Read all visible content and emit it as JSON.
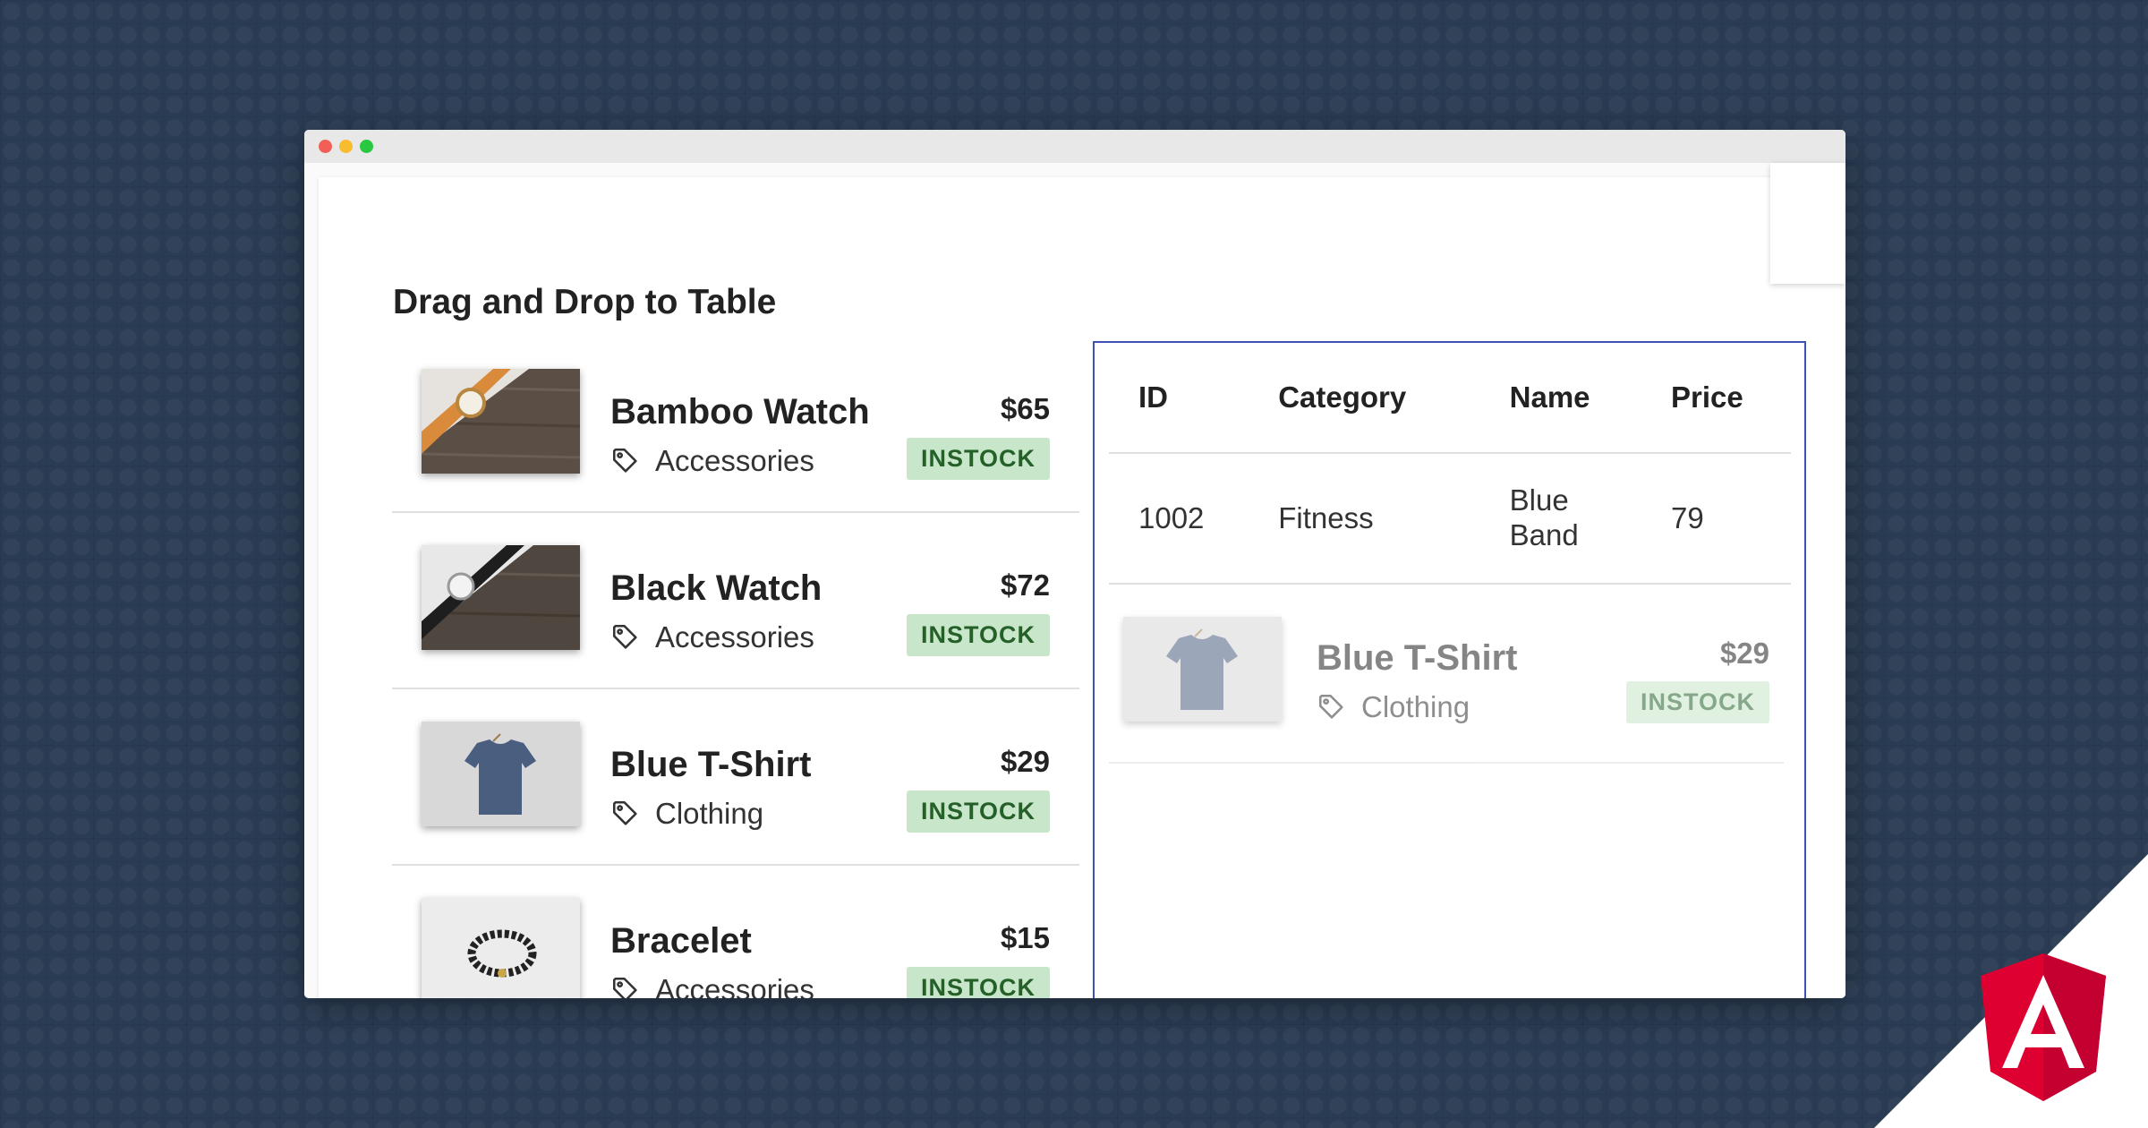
{
  "page": {
    "title": "Drag and Drop to Table"
  },
  "products": [
    {
      "name": "Bamboo Watch",
      "category": "Accessories",
      "price": "$65",
      "status": "INSTOCK",
      "image_icon": "bamboo-watch-image"
    },
    {
      "name": "Black Watch",
      "category": "Accessories",
      "price": "$72",
      "status": "INSTOCK",
      "image_icon": "black-watch-image"
    },
    {
      "name": "Blue T-Shirt",
      "category": "Clothing",
      "price": "$29",
      "status": "INSTOCK",
      "image_icon": "blue-tshirt-image"
    },
    {
      "name": "Bracelet",
      "category": "Accessories",
      "price": "$15",
      "status": "INSTOCK",
      "image_icon": "bracelet-image"
    }
  ],
  "table": {
    "headers": [
      "ID",
      "Category",
      "Name",
      "Price"
    ],
    "rows": [
      {
        "id": "1002",
        "category": "Fitness",
        "name_line1": "Blue",
        "name_line2": "Band",
        "price": "79"
      }
    ]
  },
  "dragging": {
    "name": "Blue T-Shirt",
    "category": "Clothing",
    "price": "$29",
    "status": "INSTOCK"
  },
  "colors": {
    "background": "#2a3c53",
    "badge_bg": "#c8e6c9",
    "badge_text": "#256029",
    "drop_border": "#3f51b5",
    "angular_red": "#dd0031"
  },
  "icons": [
    "tag-icon",
    "angular-logo-icon"
  ]
}
